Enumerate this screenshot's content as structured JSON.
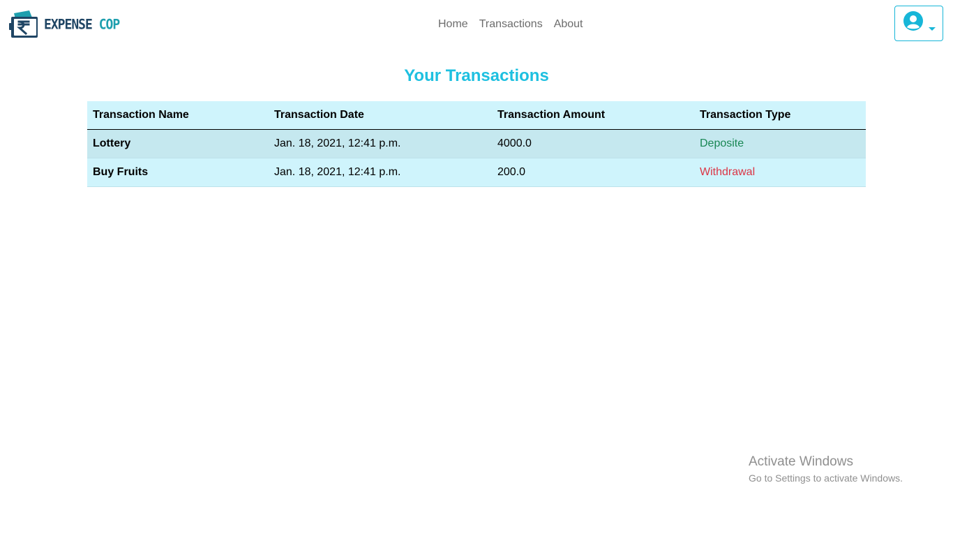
{
  "brand": {
    "name_primary": "EXPENSE",
    "name_secondary": "COP",
    "logo_icon": "rupee-wallet-icon"
  },
  "nav": {
    "items": [
      {
        "label": "Home"
      },
      {
        "label": "Transactions"
      },
      {
        "label": "About"
      }
    ]
  },
  "user_menu": {
    "icon": "user-circle-icon",
    "caret_icon": "caret-down-icon"
  },
  "page": {
    "title": "Your Transactions"
  },
  "table": {
    "headers": [
      "Transaction Name",
      "Transaction Date",
      "Transaction Amount",
      "Transaction Type"
    ],
    "rows": [
      {
        "name": "Lottery",
        "date": "Jan. 18, 2021, 12:41 p.m.",
        "amount": "4000.0",
        "type": "Deposite",
        "type_color": "#198754"
      },
      {
        "name": "Buy Fruits",
        "date": "Jan. 18, 2021, 12:41 p.m.",
        "amount": "200.0",
        "type": "Withdrawal",
        "type_color": "#dc3545"
      }
    ]
  },
  "watermark": {
    "line1": "Activate Windows",
    "line2": "Go to Settings to activate Windows."
  },
  "colors": {
    "accent": "#1ec0e0",
    "table_bg": "#cff4fc",
    "deposit": "#198754",
    "withdrawal": "#dc3545"
  }
}
